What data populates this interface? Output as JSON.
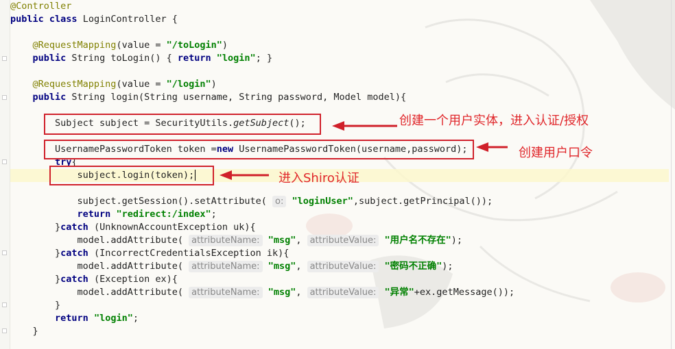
{
  "code": {
    "controller_annotation": "@Controller",
    "class_decl": {
      "kw": "public class",
      "name": "LoginController {"
    },
    "m1_annotation": "@RequestMapping",
    "m1_value_prefix": "(value = ",
    "m1_path": "\"/toLogin\"",
    "m1_close": ")",
    "m1_sig_kw": "public",
    "m1_sig": " String toLogin() { ",
    "m1_return_kw": "return",
    "m1_return_val": "\"login\"",
    "m1_end": "; }",
    "m2_annotation": "@RequestMapping",
    "m2_value_prefix": "(value = ",
    "m2_path": "\"/login\"",
    "m2_close": ")",
    "m2_sig_kw": "public",
    "m2_sig": " String login(String username, String password, Model model){",
    "subject_pre": "Subject subject = SecurityUtils.",
    "subject_method": "getSubject",
    "subject_post": "();",
    "token_pre": "UsernamePasswordToken token =",
    "token_kw": "new",
    "token_post": " UsernamePasswordToken(username,password);",
    "try_kw": "try",
    "try_brace": "{",
    "login_call": "subject.login(token);",
    "session_pre": "subject.getSession().setAttribute( ",
    "session_hint": "o:",
    "session_key": "\"loginUser\"",
    "session_post": ",subject.getPrincipal());",
    "redirect_kw": "return",
    "redirect_val": "\"redirect:/index\"",
    "redirect_end": ";",
    "catch1_pre": "}",
    "catch1_kw": "catch",
    "catch1_post": " (UnknownAccountException uk){",
    "catch2_pre": "}",
    "catch2_kw": "catch",
    "catch2_post": " (IncorrectCredentialsException ik){",
    "catch3_pre": "}",
    "catch3_kw": "catch",
    "catch3_post": " (Exception ex){",
    "add_pre": "model.addAttribute( ",
    "hint_name": "attributeName:",
    "hint_value": "attributeValue:",
    "msg_key": "\"msg\"",
    "comma": ", ",
    "msg_user_missing": "\"用户名不存在\"",
    "msg_wrong_pwd": "\"密码不正确\"",
    "msg_exception": "\"异常\"",
    "add_end": ");",
    "ex_suffix": "+ex.getMessage());",
    "close_brace": "}",
    "final_return_kw": "return",
    "final_return_val": "\"login\"",
    "final_return_end": ";",
    "method_close": "}"
  },
  "annotations": {
    "subject_label": "创建一个用户实体，进入认证/授权",
    "token_label": "创建用户口令",
    "login_label": "进入Shiro认证"
  },
  "colors": {
    "annotation": "#808000",
    "keyword": "#000080",
    "string": "#008000",
    "callout": "#d0202a"
  }
}
